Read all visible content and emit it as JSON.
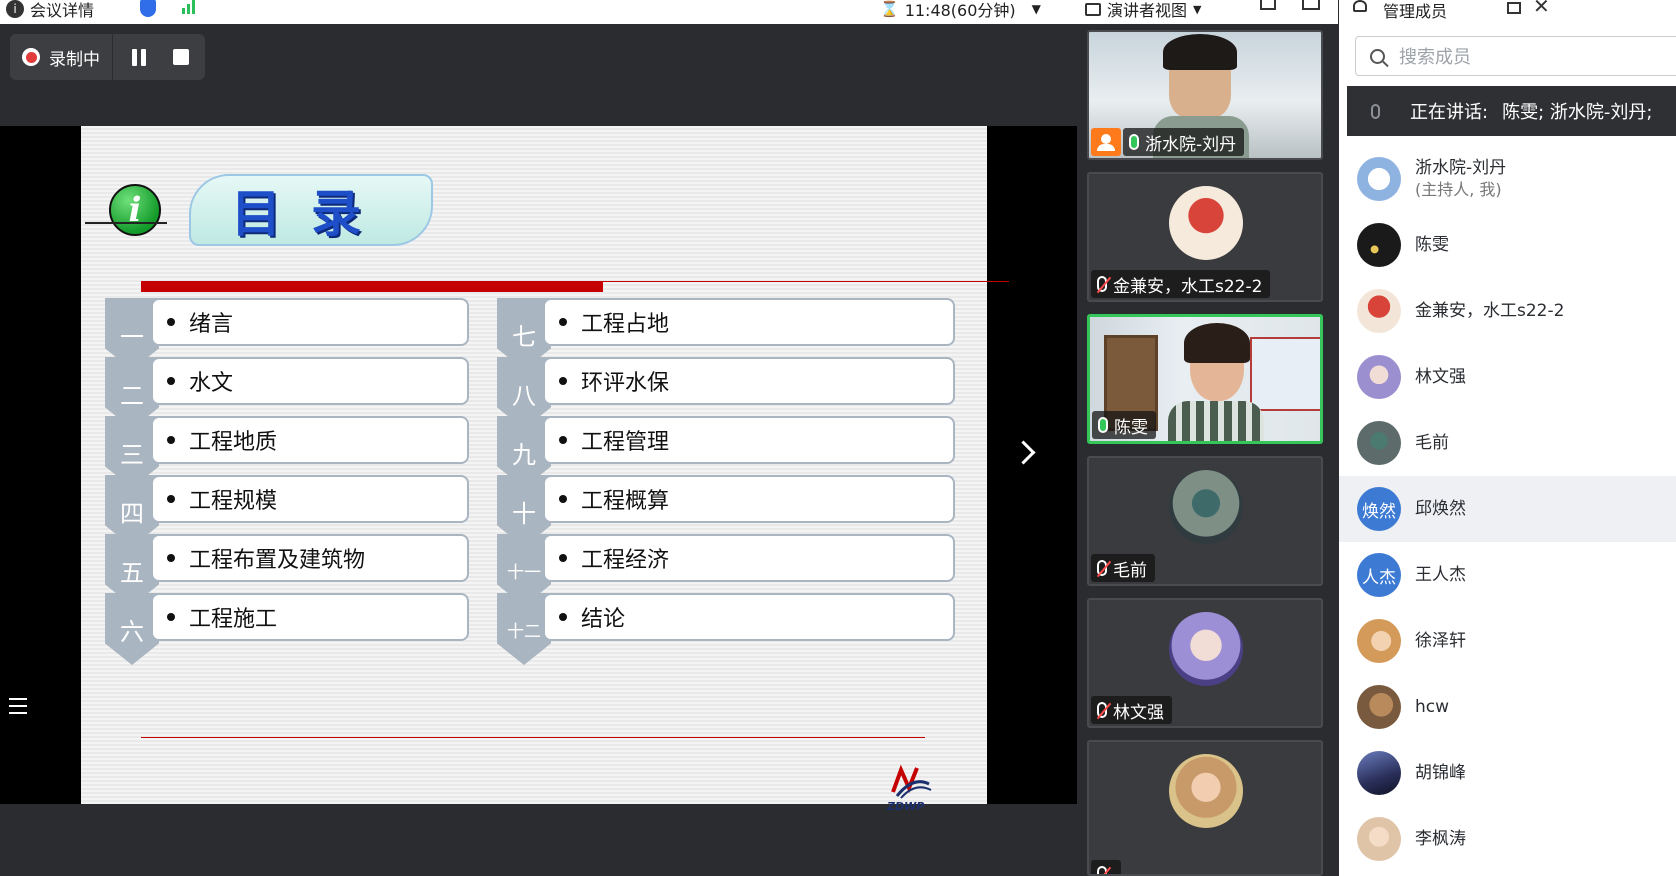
{
  "topbar": {
    "meeting_info": "会议详情",
    "info_icon": "info-icon",
    "timer": "11:48(60分钟)",
    "view_mode": "演讲者视图"
  },
  "recording": {
    "status": "录制中"
  },
  "slide": {
    "title": "目录",
    "logo_text": "ZDWP",
    "left_items": [
      {
        "num": "一",
        "label": "绪言"
      },
      {
        "num": "二",
        "label": "水文"
      },
      {
        "num": "三",
        "label": "工程地质"
      },
      {
        "num": "四",
        "label": "工程规模"
      },
      {
        "num": "五",
        "label": "工程布置及建筑物"
      },
      {
        "num": "六",
        "label": "工程施工"
      }
    ],
    "right_items": [
      {
        "num": "七",
        "label": "工程占地"
      },
      {
        "num": "八",
        "label": "环评水保"
      },
      {
        "num": "九",
        "label": "工程管理"
      },
      {
        "num": "十",
        "label": "工程概算"
      },
      {
        "num": "十一",
        "label": "工程经济"
      },
      {
        "num": "十二",
        "label": "结论"
      }
    ]
  },
  "videos": [
    {
      "name": "浙水院-刘丹",
      "mic": "on",
      "host": true
    },
    {
      "name": "金兼安，水工s22-2",
      "mic": "off"
    },
    {
      "name": "陈雯",
      "mic": "on",
      "active": true
    },
    {
      "name": "毛前",
      "mic": "off"
    },
    {
      "name": "林文强",
      "mic": "off"
    },
    {
      "name": "",
      "mic": "off"
    }
  ],
  "panel": {
    "title": "管理成员",
    "search_placeholder": "搜索成员",
    "speaking_label": "正在讲话:",
    "speaking_names": "陈雯; 浙水院-刘丹;",
    "members": [
      {
        "name": "浙水院-刘丹",
        "sub": "(主持人, 我)",
        "avatar_color": "#8fb3e0"
      },
      {
        "name": "陈雯",
        "avatar_color": "#1a1a1a"
      },
      {
        "name": "金兼安，水工s22-2",
        "avatar_color": "#f3e6d8"
      },
      {
        "name": "林文强",
        "avatar_color": "#9b8fd0"
      },
      {
        "name": "毛前",
        "avatar_color": "#5d6b6a"
      },
      {
        "name": "邱焕然",
        "avatar_text": "焕然",
        "avatar_color": "#3d7ad4"
      },
      {
        "name": "王人杰",
        "avatar_text": "人杰",
        "avatar_color": "#3d7ad4"
      },
      {
        "name": "徐泽轩",
        "avatar_color": "#d49a5a"
      },
      {
        "name": "hcw",
        "avatar_color": "#7a5a3e"
      },
      {
        "name": "胡锦峰",
        "avatar_color": "#2a2f5a"
      },
      {
        "name": "李枫涛",
        "avatar_color": "#e0c4a8"
      }
    ]
  }
}
